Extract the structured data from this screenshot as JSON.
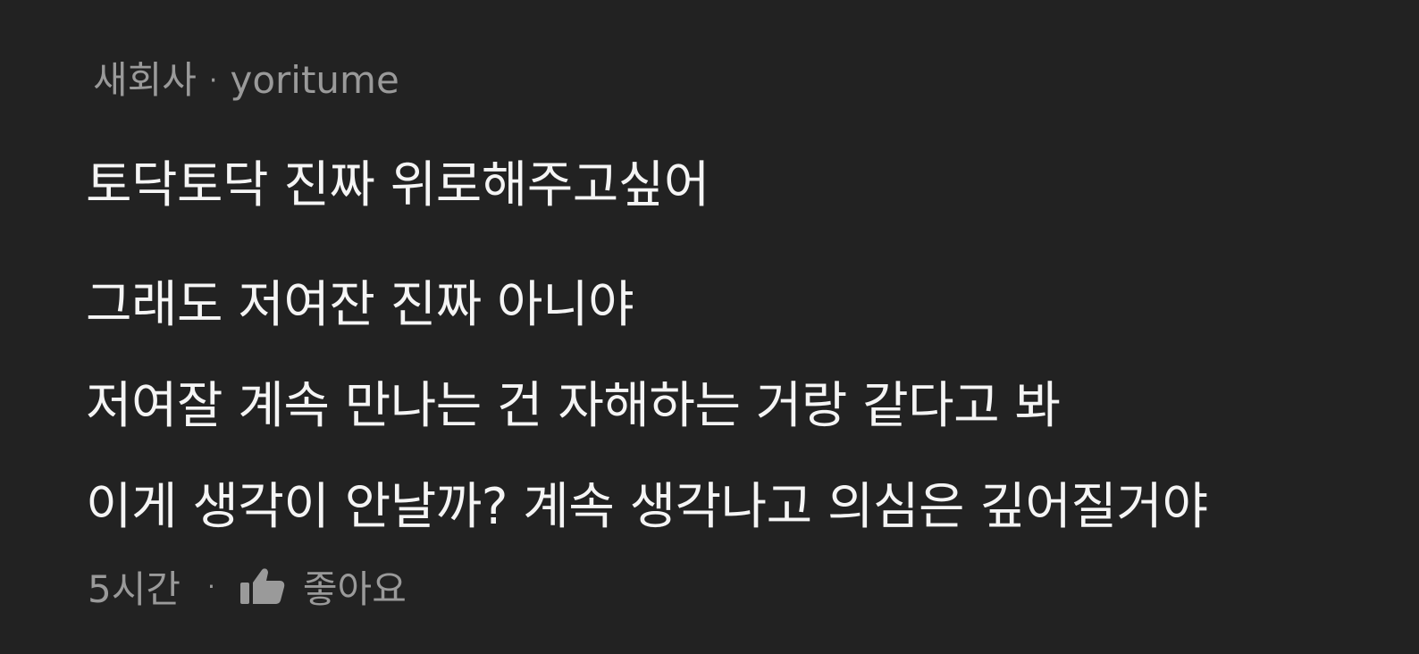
{
  "comment": {
    "source": "새회사",
    "separator": "·",
    "author": "yoritume",
    "lines": [
      "토닥토닥 진짜 위로해주고싶어",
      "그래도 저여잔 진짜 아니야",
      "저여잘 계속 만나는 건 자해하는 거랑 같다고 봐",
      "이게 생각이 안날까? 계속 생각나고 의심은 깊어질거야"
    ],
    "footer": {
      "time": "5시간",
      "separator": "·",
      "like_icon": "thumbs-up-icon",
      "like_label": "좋아요"
    }
  },
  "colors": {
    "background": "#222222",
    "text": "#f5f5f5",
    "muted": "#9a9a9a"
  }
}
